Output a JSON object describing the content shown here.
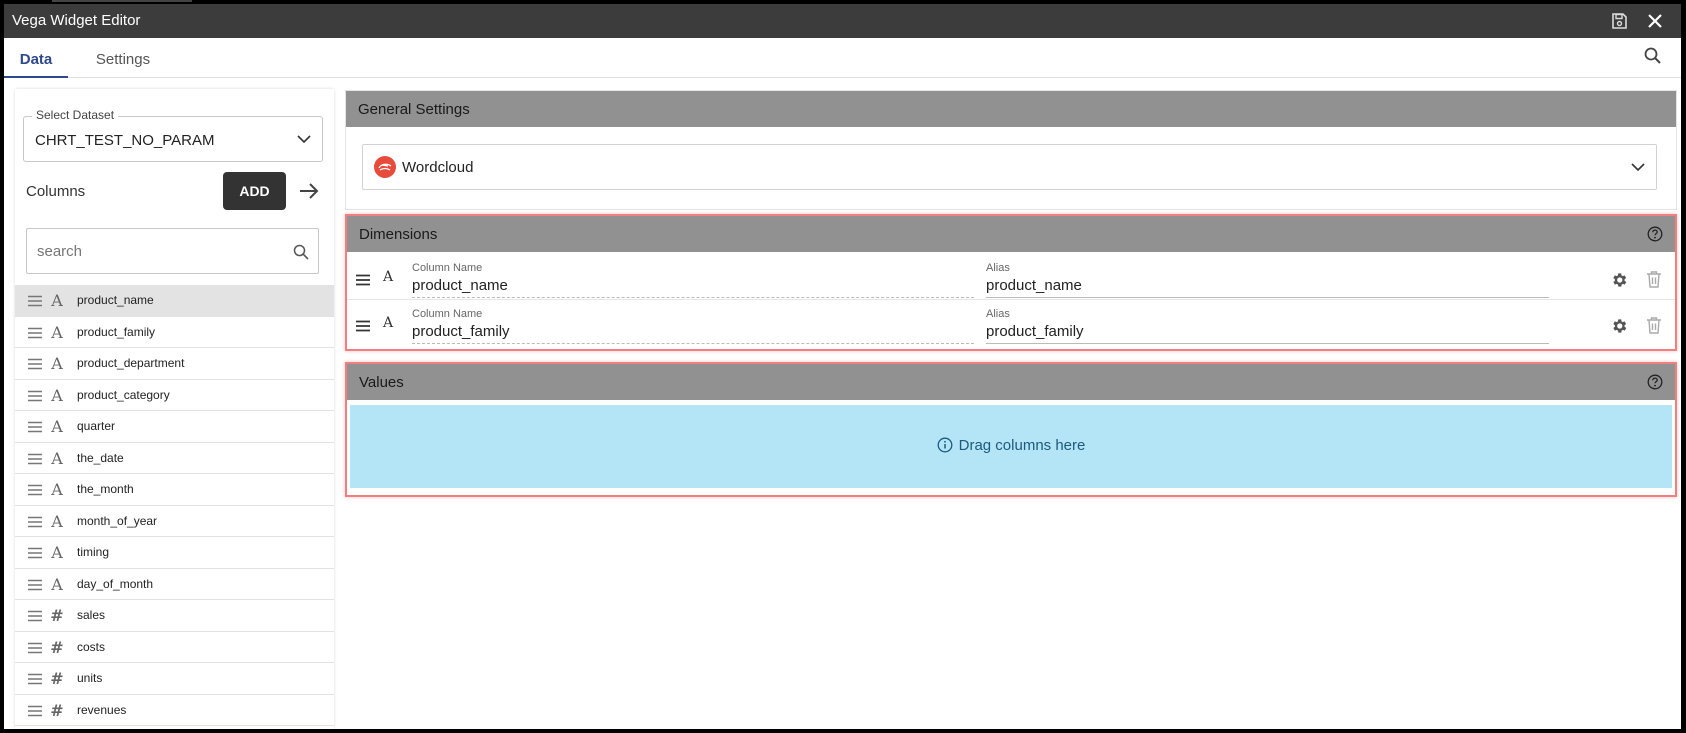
{
  "window": {
    "title": "Vega Widget Editor"
  },
  "tabs": [
    {
      "label": "Data",
      "active": true
    },
    {
      "label": "Settings",
      "active": false
    }
  ],
  "icons": {
    "save": "save-icon",
    "close": "close-icon",
    "search": "search-icon",
    "help": "help-circle-icon",
    "gear": "gear-icon",
    "trash": "trash-icon",
    "drag": "drag-handle-icon",
    "info": "info-icon"
  },
  "left": {
    "dataset_legend": "Select Dataset",
    "dataset_value": "CHRT_TEST_NO_PARAM",
    "columns_label": "Columns",
    "add_label": "ADD",
    "search_placeholder": "search",
    "columns": [
      {
        "name": "product_name",
        "type": "text",
        "glyph": "A",
        "selected": true
      },
      {
        "name": "product_family",
        "type": "text",
        "glyph": "A"
      },
      {
        "name": "product_department",
        "type": "text",
        "glyph": "A"
      },
      {
        "name": "product_category",
        "type": "text",
        "glyph": "A"
      },
      {
        "name": "quarter",
        "type": "text",
        "glyph": "A"
      },
      {
        "name": "the_date",
        "type": "text",
        "glyph": "A"
      },
      {
        "name": "the_month",
        "type": "text",
        "glyph": "A"
      },
      {
        "name": "month_of_year",
        "type": "text",
        "glyph": "A"
      },
      {
        "name": "timing",
        "type": "text",
        "glyph": "A"
      },
      {
        "name": "day_of_month",
        "type": "text",
        "glyph": "A"
      },
      {
        "name": "sales",
        "type": "number",
        "glyph": "#"
      },
      {
        "name": "costs",
        "type": "number",
        "glyph": "#"
      },
      {
        "name": "units",
        "type": "number",
        "glyph": "#"
      },
      {
        "name": "revenues",
        "type": "number",
        "glyph": "#"
      }
    ]
  },
  "general": {
    "header": "General Settings",
    "chart_type": "Wordcloud"
  },
  "dimensions": {
    "header": "Dimensions",
    "column_label": "Column Name",
    "alias_label": "Alias",
    "type_glyph": "A",
    "rows": [
      {
        "column": "product_name",
        "alias": "product_name"
      },
      {
        "column": "product_family",
        "alias": "product_family"
      }
    ]
  },
  "values": {
    "header": "Values",
    "dropzone_text": "Drag columns here"
  },
  "colors": {
    "titlebar": "#3c3c3c",
    "accent": "#2e4a8c",
    "section_header": "#919191",
    "highlight_border": "#f08080",
    "dropzone": "#b3e5f7",
    "logo": "#e74b3c"
  }
}
